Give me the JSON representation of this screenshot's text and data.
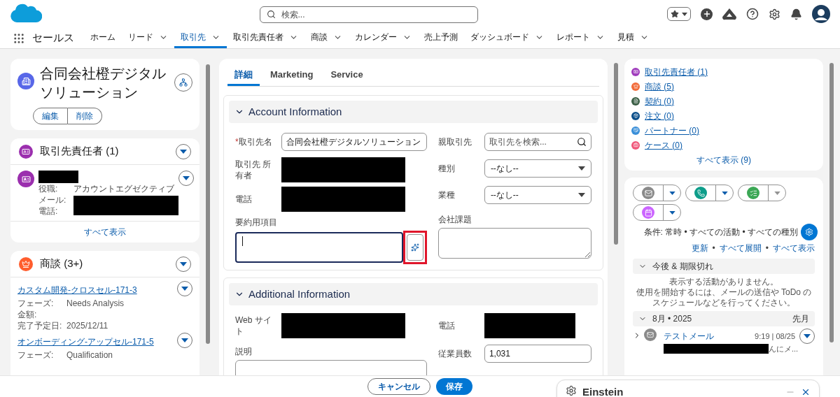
{
  "app": {
    "name": "セールス"
  },
  "search": {
    "placeholder": "検索..."
  },
  "nav_tabs": [
    {
      "label": "ホーム",
      "selected": false,
      "has_menu": false
    },
    {
      "label": "リード",
      "selected": false,
      "has_menu": true
    },
    {
      "label": "取引先",
      "selected": true,
      "has_menu": true
    },
    {
      "label": "取引先責任者",
      "selected": false,
      "has_menu": true
    },
    {
      "label": "商談",
      "selected": false,
      "has_menu": true
    },
    {
      "label": "カレンダー",
      "selected": false,
      "has_menu": true
    },
    {
      "label": "売上予測",
      "selected": false,
      "has_menu": false
    },
    {
      "label": "ダッシュボード",
      "selected": false,
      "has_menu": true
    },
    {
      "label": "レポート",
      "selected": false,
      "has_menu": true
    },
    {
      "label": "見積",
      "selected": false,
      "has_menu": true
    }
  ],
  "record": {
    "title": "合同会社橙デジタルソリューション",
    "actions": [
      "編集",
      "削除"
    ]
  },
  "contacts_card": {
    "title": "取引先責任者 (1)",
    "fields": [
      {
        "label": "役職:",
        "value": "アカウントエグゼクティブ"
      },
      {
        "label": "メール:"
      },
      {
        "label": "電話:"
      }
    ],
    "view_all": "すべて表示"
  },
  "opportunities_card": {
    "title": "商談 (3+)",
    "items": [
      {
        "name": "カスタム開発-クロスセル-171-3",
        "fields": [
          {
            "label": "フェーズ:",
            "value": "Needs Analysis"
          },
          {
            "label": "金額:"
          },
          {
            "label": "完了予定日:",
            "value": "2025/12/11"
          }
        ]
      },
      {
        "name": "オンボーディング-アップセル-171-5",
        "fields": [
          {
            "label": "フェーズ:",
            "value": "Qualification"
          }
        ]
      }
    ]
  },
  "detail_tabs": [
    {
      "label": "詳細",
      "selected": true
    },
    {
      "label": "Marketing",
      "selected": false
    },
    {
      "label": "Service",
      "selected": false
    }
  ],
  "sections": [
    {
      "title": "Account Information",
      "expanded": true,
      "left": [
        {
          "kind": "text",
          "label": "取引先名",
          "required_mark": "*",
          "value": "合同会社橙デジタルソリューション"
        },
        {
          "kind": "redacted",
          "label": "取引先 所有者"
        },
        {
          "kind": "redacted",
          "label": "電話"
        },
        {
          "kind": "ai_textarea",
          "label": "要約用項目",
          "highlighted": true
        }
      ],
      "right": [
        {
          "kind": "lookup",
          "label": "親取引先",
          "placeholder": "取引先を検索..."
        },
        {
          "kind": "select",
          "label": "種別",
          "value": "--なし--"
        },
        {
          "kind": "select",
          "label": "業種",
          "value": "--なし--"
        },
        {
          "kind": "textarea",
          "label": "会社課題"
        }
      ]
    },
    {
      "title": "Additional Information",
      "expanded": true,
      "left": [
        {
          "kind": "redacted",
          "label": "Web サイト"
        },
        {
          "kind": "textarea",
          "label": "説明"
        }
      ],
      "right": [
        {
          "kind": "redacted",
          "label": "電話"
        },
        {
          "kind": "text",
          "label": "従業員数",
          "value": "1,031"
        }
      ]
    }
  ],
  "related_links": {
    "items": [
      {
        "label": "取引先責任者 (1)",
        "kind": "contact",
        "color": "#a03cbd"
      },
      {
        "label": "商談 (5)",
        "kind": "opportunity",
        "color": "#f26b3a"
      },
      {
        "label": "契約 (0)",
        "kind": "contract",
        "color": "#3b5f46"
      },
      {
        "label": "注文 (0)",
        "kind": "order",
        "color": "#0b4f8a"
      },
      {
        "label": "パートナー (0)",
        "kind": "partner",
        "color": "#3a8fd9"
      },
      {
        "label": "ケース (0)",
        "kind": "case",
        "color": "#f0577a"
      }
    ],
    "view_all": "すべて表示 (9)"
  },
  "activity": {
    "actions": [
      {
        "kind": "email",
        "color": "#8a8a8a",
        "menu_enabled": true
      },
      {
        "kind": "call",
        "color": "#0d9d8a",
        "menu_enabled": true
      },
      {
        "kind": "task",
        "color": "#3ba755",
        "menu_enabled": false
      },
      {
        "kind": "event",
        "color": "#cb65ff",
        "menu_enabled": true
      }
    ],
    "filter": "条件: 常時 • すべての活動 • すべての種別",
    "links": [
      "更新",
      "すべて展開",
      "すべて表示"
    ],
    "link_separator": "•",
    "upcoming": {
      "title": "今後 & 期限切れ",
      "expanded": true,
      "messages": [
        "表示する活動がありません。",
        "使用を開始するには、メールの送信や ToDo のスケジュールなどを行ってください。"
      ]
    },
    "month": {
      "title": "8月 • 2025",
      "note": "先月",
      "expanded": true,
      "items": [
        {
          "subject": "テストメール",
          "time": "9:19 | 08/25",
          "snippet": "んにメ...",
          "expanded": false
        }
      ]
    }
  },
  "footer": {
    "buttons": [
      "キャンセル",
      "保存"
    ]
  },
  "einstein": {
    "title": "Einstein"
  }
}
